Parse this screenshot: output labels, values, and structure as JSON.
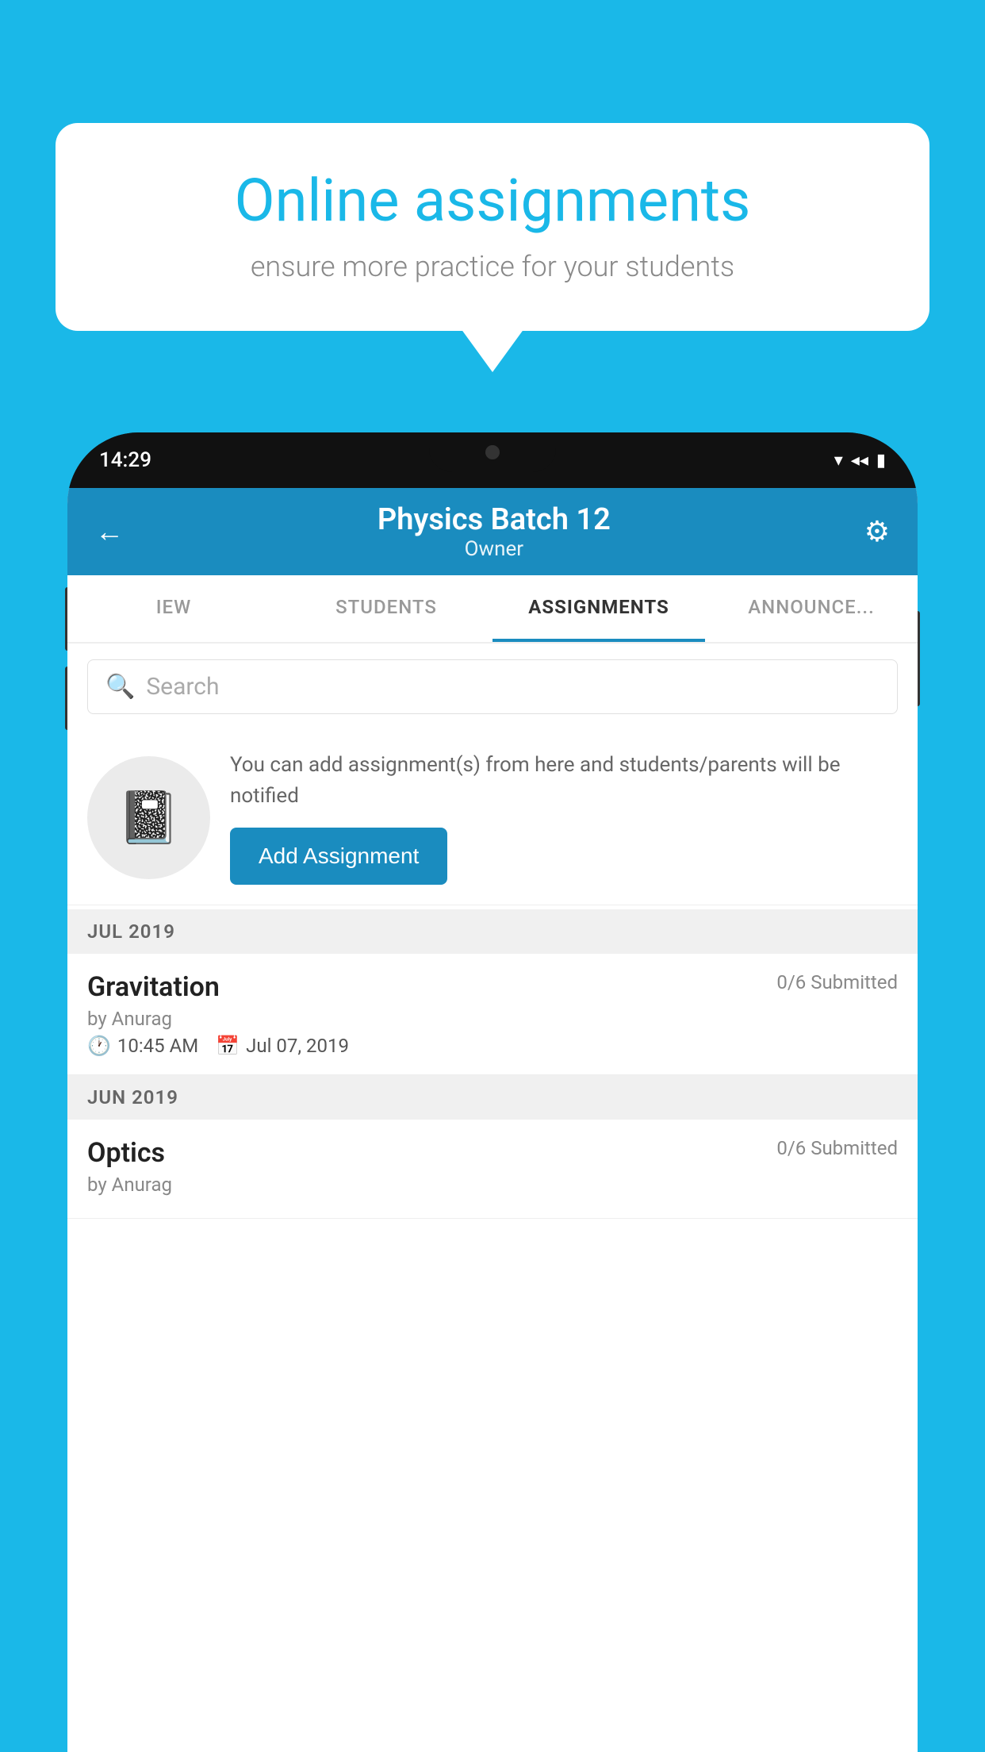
{
  "background_color": "#1ab8e8",
  "speech_bubble": {
    "title": "Online assignments",
    "subtitle": "ensure more practice for your students"
  },
  "phone": {
    "status_bar": {
      "time": "14:29",
      "wifi": "▾",
      "signal": "◂",
      "battery": "▮"
    },
    "header": {
      "title": "Physics Batch 12",
      "subtitle": "Owner",
      "back_label": "←",
      "settings_label": "⚙"
    },
    "tabs": [
      {
        "label": "IEW",
        "active": false
      },
      {
        "label": "STUDENTS",
        "active": false
      },
      {
        "label": "ASSIGNMENTS",
        "active": true
      },
      {
        "label": "ANNOUNCEMENTS",
        "active": false
      }
    ],
    "search": {
      "placeholder": "Search"
    },
    "promo": {
      "description": "You can add assignment(s) from here and students/parents will be notified",
      "button_label": "Add Assignment"
    },
    "sections": [
      {
        "month_label": "JUL 2019",
        "assignments": [
          {
            "name": "Gravitation",
            "submitted": "0/6 Submitted",
            "by": "by Anurag",
            "time": "10:45 AM",
            "date": "Jul 07, 2019"
          }
        ]
      },
      {
        "month_label": "JUN 2019",
        "assignments": [
          {
            "name": "Optics",
            "submitted": "0/6 Submitted",
            "by": "by Anurag",
            "time": "",
            "date": ""
          }
        ]
      }
    ]
  }
}
